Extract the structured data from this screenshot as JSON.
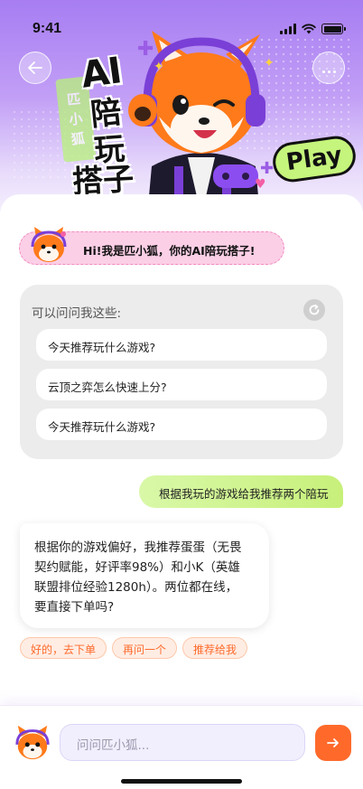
{
  "status_bar": {
    "time": "9:41"
  },
  "header": {
    "back_icon": "arrow-left-icon",
    "more_icon": "more-dots-icon",
    "title_ai": "AI",
    "title_lines": [
      "陪",
      "玩",
      "搭子"
    ],
    "side_tag": [
      "匹",
      "小",
      "狐"
    ],
    "play_badge": "Play"
  },
  "greeting": {
    "text": "Hi!我是匹小狐，你的AI陪玩搭子!"
  },
  "suggestions": {
    "title": "可以问问我这些:",
    "refresh_icon": "refresh-icon",
    "items": [
      "今天推荐玩什么游戏?",
      "云顶之弈怎么快速上分?",
      "今天推荐玩什么游戏?"
    ]
  },
  "chat": {
    "user_message": "根据我玩的游戏给我推荐两个陪玩",
    "ai_reply_lines": [
      "根据你的游戏偏好，我推荐蛋蛋（无畏",
      "契约赋能，好评率98%）和小K（英雄",
      "联盟排位经验1280h）。两位都在线，",
      "要直接下单吗?"
    ],
    "quick_replies": [
      "好的，去下单",
      "再问一个",
      "推荐给我"
    ]
  },
  "composer": {
    "placeholder": "问问匹小狐...",
    "send_icon": "arrow-right-icon"
  },
  "colors": {
    "accent": "#ff6a2b",
    "hero_purple": "#a77df2",
    "lime": "#c5f57c",
    "pink": "#fbcfe6"
  }
}
